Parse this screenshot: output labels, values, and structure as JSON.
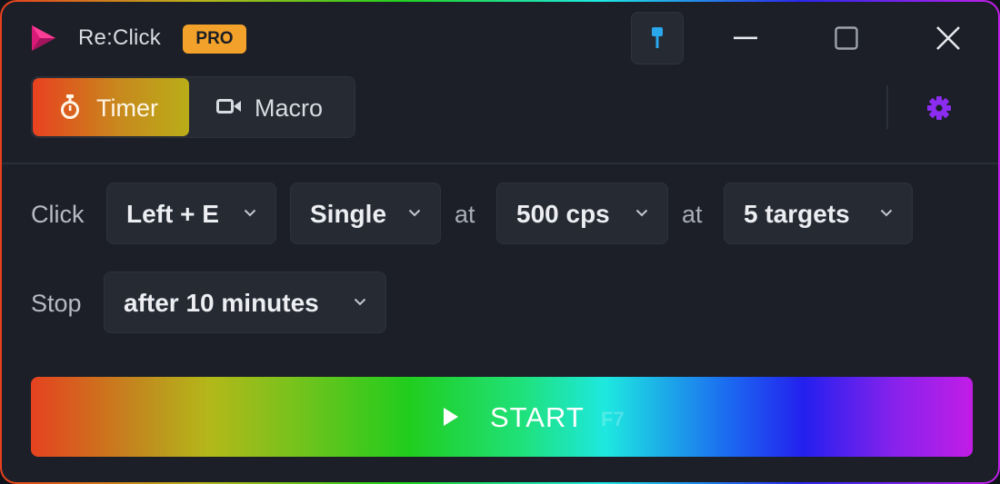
{
  "app": {
    "title": "Re:Click",
    "badge": "PRO",
    "accent_gradient": [
      "#e8401f",
      "#b8b41a",
      "#22d11e",
      "#1de9e3",
      "#2a28f0",
      "#c21fe8"
    ]
  },
  "titlebar": {
    "pin_icon": "pin-icon",
    "minimize_icon": "minimize-icon",
    "maximize_icon": "maximize-icon",
    "close_icon": "close-icon"
  },
  "modes": {
    "tabs": [
      {
        "label": "Timer",
        "icon": "stopwatch-icon",
        "selected": true
      },
      {
        "label": "Macro",
        "icon": "video-camera-icon",
        "selected": false
      }
    ],
    "settings_icon": "gear-icon"
  },
  "click_row": {
    "label": "Click",
    "button": "Left + E",
    "mode": "Single",
    "at1": "at",
    "rate": "500 cps",
    "at2": "at",
    "targets": "5 targets"
  },
  "stop_row": {
    "label": "Stop",
    "condition": "after 10 minutes"
  },
  "start": {
    "label": "START",
    "hotkey": "F7"
  }
}
